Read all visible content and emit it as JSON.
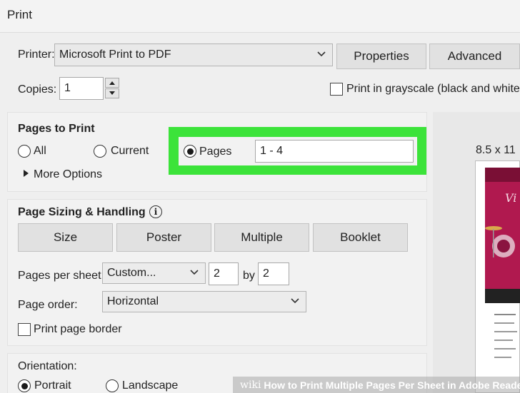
{
  "window": {
    "title": "Print"
  },
  "printer": {
    "label": "Printer:",
    "value": "Microsoft Print to PDF",
    "properties_label": "Properties",
    "advanced_label": "Advanced"
  },
  "copies": {
    "label": "Copies:",
    "value": "1"
  },
  "grayscale": {
    "label": "Print in grayscale (black and white)",
    "checked": false
  },
  "pages_to_print": {
    "title": "Pages to Print",
    "all_label": "All",
    "current_label": "Current",
    "pages_label": "Pages",
    "pages_value": "1 - 4",
    "selected": "Pages",
    "more_options_label": "More Options"
  },
  "sizing": {
    "title": "Page Sizing & Handling",
    "tabs": [
      "Size",
      "Poster",
      "Multiple",
      "Booklet"
    ],
    "pages_per_sheet_label": "Pages per sheet:",
    "pages_per_sheet_value": "Custom...",
    "cols_value": "2",
    "by_label": "by",
    "rows_value": "2",
    "page_order_label": "Page order:",
    "page_order_value": "Horizontal",
    "print_border_label": "Print page border"
  },
  "orientation": {
    "title": "Orientation:",
    "portrait_label": "Portrait",
    "landscape_label": "Landscape",
    "selected": "Portrait"
  },
  "preview": {
    "paper_size": "8.5 x 11"
  },
  "watermark": {
    "wiki": "wiki",
    "text": "How to Print Multiple Pages Per Sheet in Adobe Reader"
  },
  "colors": {
    "highlight": "#3ce33a",
    "poster_accent": "#b0194f"
  }
}
